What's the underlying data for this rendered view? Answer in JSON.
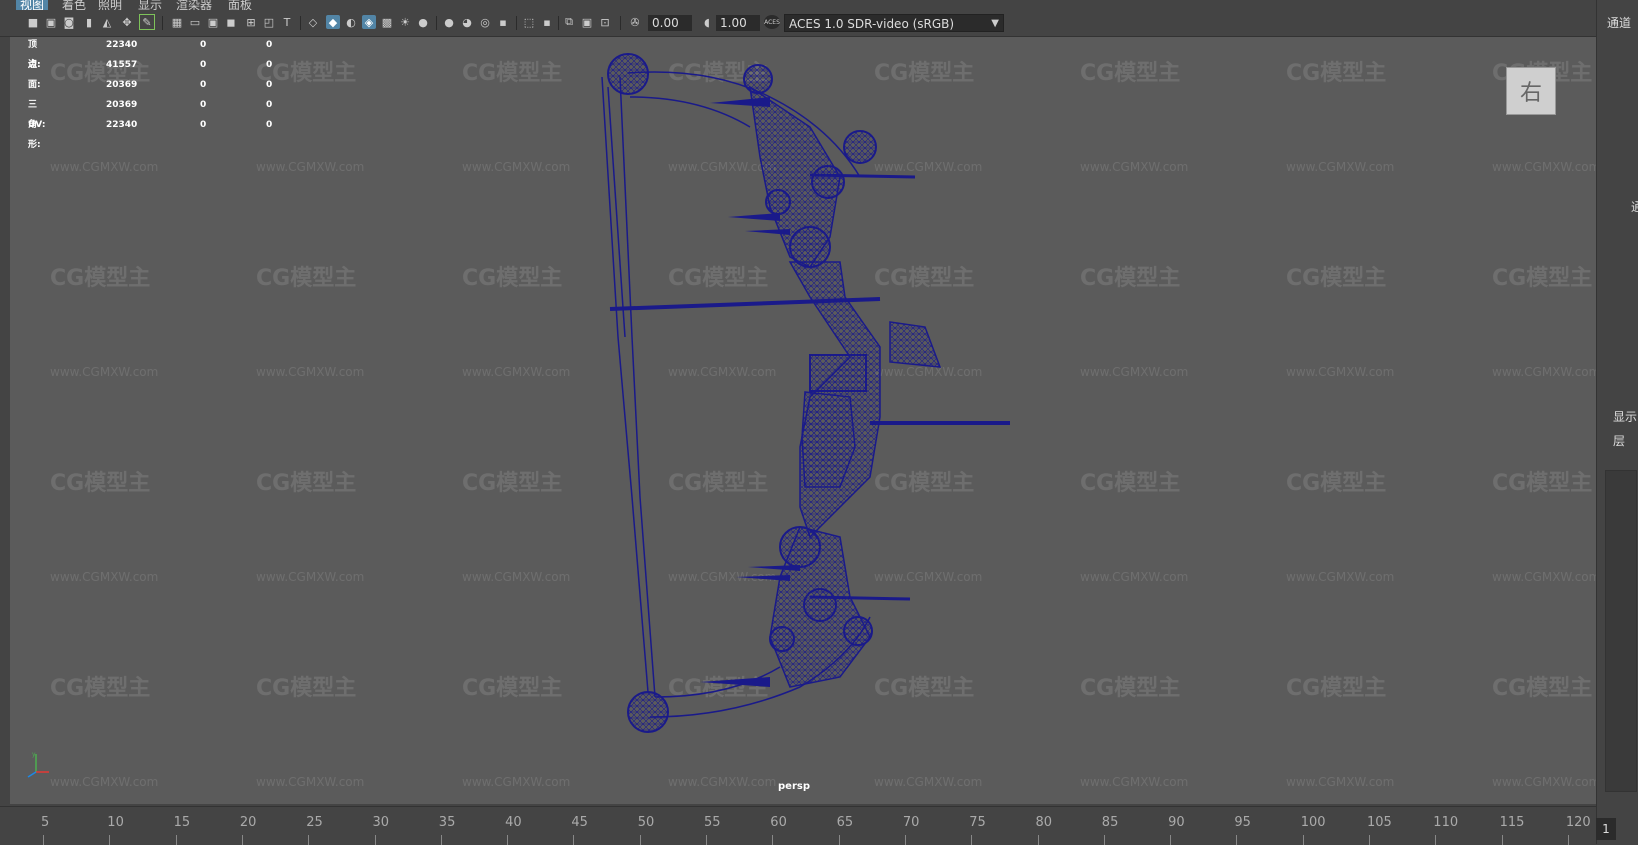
{
  "menu": {
    "items": [
      {
        "label": "视图",
        "active": true
      },
      {
        "label": "着色",
        "active": false
      },
      {
        "label": "照明",
        "active": false
      },
      {
        "label": "显示",
        "active": false
      },
      {
        "label": "渲染器",
        "active": false
      },
      {
        "label": "面板",
        "active": false
      }
    ]
  },
  "toolbar": {
    "field_a": "0.00",
    "field_b": "1.00",
    "colorspace": "ACES 1.0 SDR-video (sRGB)",
    "colorspace_icon": "ACES"
  },
  "hud": {
    "rows": [
      {
        "label": "顶点:",
        "v1": "22340",
        "v2": "0",
        "v3": "0"
      },
      {
        "label": "边:",
        "v1": "41557",
        "v2": "0",
        "v3": "0"
      },
      {
        "label": "面:",
        "v1": "20369",
        "v2": "0",
        "v3": "0"
      },
      {
        "label": "三角形:",
        "v1": "20369",
        "v2": "0",
        "v3": "0"
      },
      {
        "label": "UV:",
        "v1": "22340",
        "v2": "0",
        "v3": "0"
      }
    ]
  },
  "viewport": {
    "camera": "persp",
    "viewcube_label": "右",
    "wire_color": "#1a1a8a",
    "bg_color": "#5b5b5b"
  },
  "watermark": {
    "logo": "CG模型主",
    "url": "www.CGMXW.com"
  },
  "timeline": {
    "ticks": [
      "5",
      "10",
      "15",
      "20",
      "25",
      "30",
      "35",
      "40",
      "45",
      "50",
      "55",
      "60",
      "65",
      "70",
      "75",
      "80",
      "85",
      "90",
      "95",
      "100",
      "105",
      "110",
      "115",
      "120"
    ],
    "current_frame": "1"
  },
  "right_panel": {
    "channels": "通道",
    "channels_2": "通",
    "display": "显示",
    "layers": "层"
  }
}
